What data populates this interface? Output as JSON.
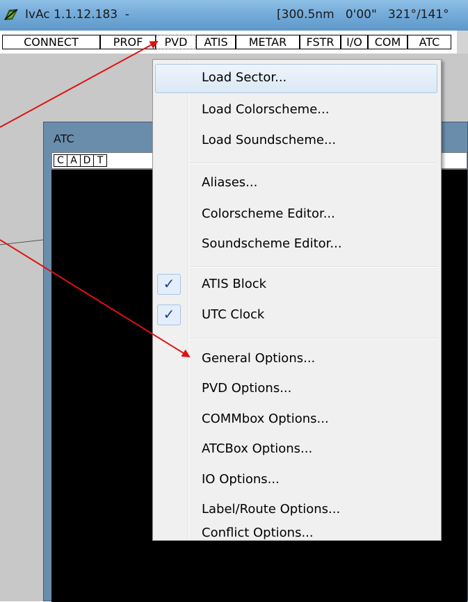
{
  "window": {
    "title": "IvAc 1.1.12.183  -",
    "status": "[300.5nm   0'00\"   321°/141°"
  },
  "toolbar": {
    "buttons": [
      "CONNECT",
      "PROF",
      "PVD",
      "ATIS",
      "METAR",
      "FSTR",
      "I/O",
      "COM",
      "ATC"
    ]
  },
  "atc_window": {
    "title": "ATC",
    "tabs": [
      "C",
      "A",
      "D",
      "T"
    ]
  },
  "menu": {
    "items": [
      {
        "label": "Load Sector...",
        "highlighted": true
      },
      {
        "label": "Load Colorscheme..."
      },
      {
        "label": "Load Soundscheme..."
      },
      {
        "label": "Aliases..."
      },
      {
        "label": "Colorscheme Editor..."
      },
      {
        "label": "Soundscheme Editor..."
      },
      {
        "label": "ATIS Block",
        "checked": true
      },
      {
        "label": "UTC Clock",
        "checked": true
      },
      {
        "label": "General Options..."
      },
      {
        "label": "PVD Options..."
      },
      {
        "label": "COMMbox Options..."
      },
      {
        "label": "ATCBox Options..."
      },
      {
        "label": "IO Options..."
      },
      {
        "label": "Label/Route Options..."
      },
      {
        "label": "Conflict Options..."
      }
    ],
    "check_glyph": "✓"
  },
  "colors": {
    "annotation_arrow": "#e01010",
    "titlebar": "#6ea6d6",
    "menu_background": "#f0f0f0",
    "check": "#1d3f8a"
  },
  "icons": {
    "app_icon": "ivac-logo-icon",
    "check": "checkmark-icon"
  }
}
